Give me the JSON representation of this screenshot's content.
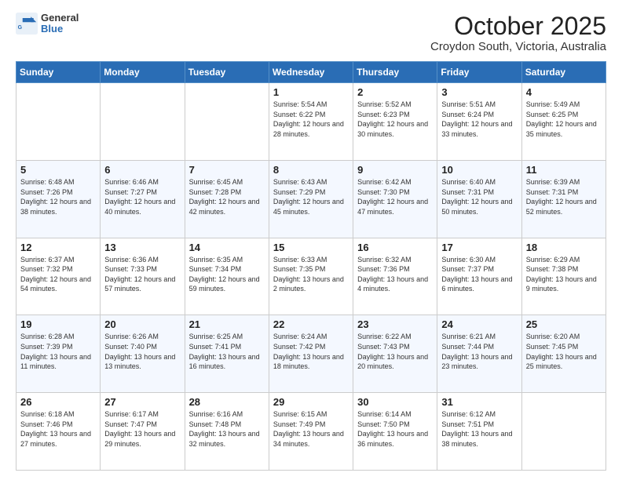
{
  "header": {
    "logo_general": "General",
    "logo_blue": "Blue",
    "title": "October 2025",
    "subtitle": "Croydon South, Victoria, Australia"
  },
  "days_of_week": [
    "Sunday",
    "Monday",
    "Tuesday",
    "Wednesday",
    "Thursday",
    "Friday",
    "Saturday"
  ],
  "weeks": [
    [
      {
        "day": "",
        "info": ""
      },
      {
        "day": "",
        "info": ""
      },
      {
        "day": "",
        "info": ""
      },
      {
        "day": "1",
        "info": "Sunrise: 5:54 AM\nSunset: 6:22 PM\nDaylight: 12 hours and 28 minutes."
      },
      {
        "day": "2",
        "info": "Sunrise: 5:52 AM\nSunset: 6:23 PM\nDaylight: 12 hours and 30 minutes."
      },
      {
        "day": "3",
        "info": "Sunrise: 5:51 AM\nSunset: 6:24 PM\nDaylight: 12 hours and 33 minutes."
      },
      {
        "day": "4",
        "info": "Sunrise: 5:49 AM\nSunset: 6:25 PM\nDaylight: 12 hours and 35 minutes."
      }
    ],
    [
      {
        "day": "5",
        "info": "Sunrise: 6:48 AM\nSunset: 7:26 PM\nDaylight: 12 hours and 38 minutes."
      },
      {
        "day": "6",
        "info": "Sunrise: 6:46 AM\nSunset: 7:27 PM\nDaylight: 12 hours and 40 minutes."
      },
      {
        "day": "7",
        "info": "Sunrise: 6:45 AM\nSunset: 7:28 PM\nDaylight: 12 hours and 42 minutes."
      },
      {
        "day": "8",
        "info": "Sunrise: 6:43 AM\nSunset: 7:29 PM\nDaylight: 12 hours and 45 minutes."
      },
      {
        "day": "9",
        "info": "Sunrise: 6:42 AM\nSunset: 7:30 PM\nDaylight: 12 hours and 47 minutes."
      },
      {
        "day": "10",
        "info": "Sunrise: 6:40 AM\nSunset: 7:31 PM\nDaylight: 12 hours and 50 minutes."
      },
      {
        "day": "11",
        "info": "Sunrise: 6:39 AM\nSunset: 7:31 PM\nDaylight: 12 hours and 52 minutes."
      }
    ],
    [
      {
        "day": "12",
        "info": "Sunrise: 6:37 AM\nSunset: 7:32 PM\nDaylight: 12 hours and 54 minutes."
      },
      {
        "day": "13",
        "info": "Sunrise: 6:36 AM\nSunset: 7:33 PM\nDaylight: 12 hours and 57 minutes."
      },
      {
        "day": "14",
        "info": "Sunrise: 6:35 AM\nSunset: 7:34 PM\nDaylight: 12 hours and 59 minutes."
      },
      {
        "day": "15",
        "info": "Sunrise: 6:33 AM\nSunset: 7:35 PM\nDaylight: 13 hours and 2 minutes."
      },
      {
        "day": "16",
        "info": "Sunrise: 6:32 AM\nSunset: 7:36 PM\nDaylight: 13 hours and 4 minutes."
      },
      {
        "day": "17",
        "info": "Sunrise: 6:30 AM\nSunset: 7:37 PM\nDaylight: 13 hours and 6 minutes."
      },
      {
        "day": "18",
        "info": "Sunrise: 6:29 AM\nSunset: 7:38 PM\nDaylight: 13 hours and 9 minutes."
      }
    ],
    [
      {
        "day": "19",
        "info": "Sunrise: 6:28 AM\nSunset: 7:39 PM\nDaylight: 13 hours and 11 minutes."
      },
      {
        "day": "20",
        "info": "Sunrise: 6:26 AM\nSunset: 7:40 PM\nDaylight: 13 hours and 13 minutes."
      },
      {
        "day": "21",
        "info": "Sunrise: 6:25 AM\nSunset: 7:41 PM\nDaylight: 13 hours and 16 minutes."
      },
      {
        "day": "22",
        "info": "Sunrise: 6:24 AM\nSunset: 7:42 PM\nDaylight: 13 hours and 18 minutes."
      },
      {
        "day": "23",
        "info": "Sunrise: 6:22 AM\nSunset: 7:43 PM\nDaylight: 13 hours and 20 minutes."
      },
      {
        "day": "24",
        "info": "Sunrise: 6:21 AM\nSunset: 7:44 PM\nDaylight: 13 hours and 23 minutes."
      },
      {
        "day": "25",
        "info": "Sunrise: 6:20 AM\nSunset: 7:45 PM\nDaylight: 13 hours and 25 minutes."
      }
    ],
    [
      {
        "day": "26",
        "info": "Sunrise: 6:18 AM\nSunset: 7:46 PM\nDaylight: 13 hours and 27 minutes."
      },
      {
        "day": "27",
        "info": "Sunrise: 6:17 AM\nSunset: 7:47 PM\nDaylight: 13 hours and 29 minutes."
      },
      {
        "day": "28",
        "info": "Sunrise: 6:16 AM\nSunset: 7:48 PM\nDaylight: 13 hours and 32 minutes."
      },
      {
        "day": "29",
        "info": "Sunrise: 6:15 AM\nSunset: 7:49 PM\nDaylight: 13 hours and 34 minutes."
      },
      {
        "day": "30",
        "info": "Sunrise: 6:14 AM\nSunset: 7:50 PM\nDaylight: 13 hours and 36 minutes."
      },
      {
        "day": "31",
        "info": "Sunrise: 6:12 AM\nSunset: 7:51 PM\nDaylight: 13 hours and 38 minutes."
      },
      {
        "day": "",
        "info": ""
      }
    ]
  ]
}
